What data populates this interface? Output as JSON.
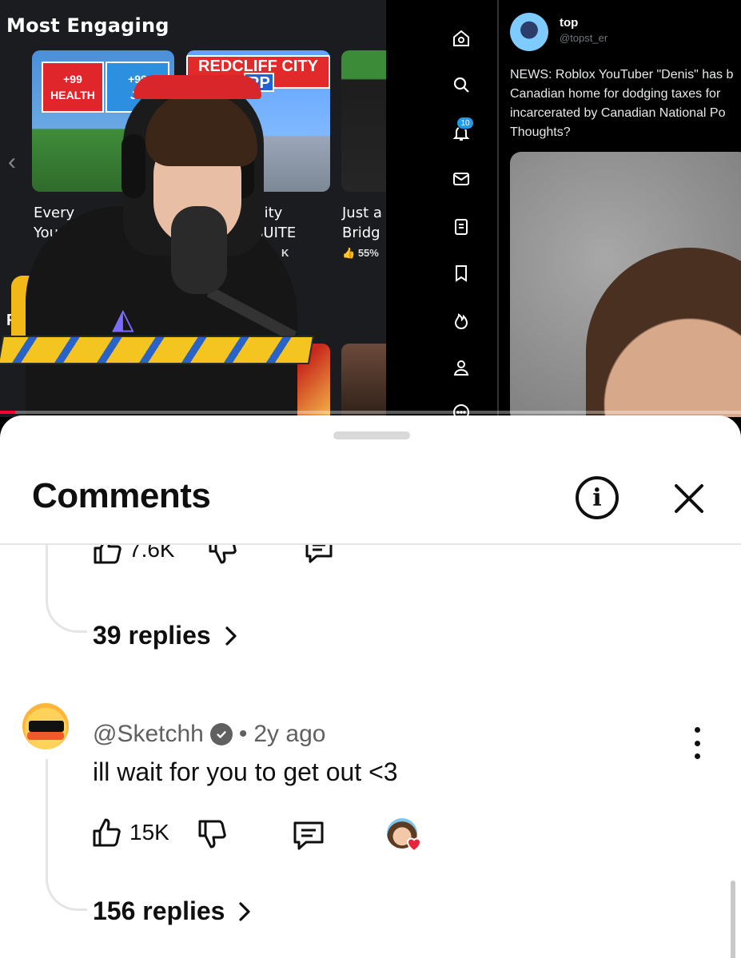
{
  "video": {
    "section_title": "Most Engaging",
    "row_letter": "R",
    "thumbnails": [
      {
        "badge_1": "+99\nHEALTH",
        "badge_2": "+99\nJU",
        "title": "Every\nYou",
        "rating": ""
      },
      {
        "logo": "REDCLIFF CITY",
        "logo_sub": "RP",
        "title": "City\nSUITE",
        "rating": "K"
      },
      {
        "title": "Just a\nBridg",
        "rating": "55%"
      }
    ],
    "progress_fraction": 0.02,
    "progress_color": "#ff0033"
  },
  "twitter": {
    "nav_icons": [
      "home-icon",
      "search-icon",
      "notifications-icon",
      "messages-icon",
      "lists-icon",
      "bookmarks-icon",
      "communities-icon",
      "profile-icon",
      "more-icon"
    ],
    "notification_count": "10",
    "tweet": {
      "name": "top",
      "handle": "@topst_er",
      "text": "NEWS: Roblox YouTuber \"Denis\" has b\nCanadian home for dodging taxes for\nincarcerated by Canadian National Po\nThoughts?"
    }
  },
  "comments_sheet": {
    "title": "Comments",
    "info_icon": "info-icon",
    "close_icon": "close-icon",
    "previous_thread": {
      "like_count": "7.6K",
      "replies_label": "39 replies"
    },
    "comment": {
      "author": "@Sketchh",
      "verified": true,
      "separator": "•",
      "time": "2y ago",
      "text": "ill wait for you to get out <3",
      "like_count": "15K",
      "creator_hearted": true,
      "replies_label": "156 replies"
    },
    "colors": {
      "heart": "#e8243b",
      "text": "#0f0f0f",
      "meta": "#606060"
    }
  }
}
